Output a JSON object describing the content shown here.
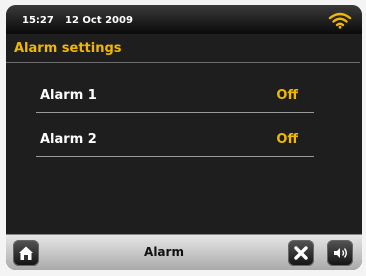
{
  "status": {
    "time": "15:27",
    "date": "12 Oct  2009",
    "wifi_icon": "wifi-icon"
  },
  "page": {
    "title": "Alarm settings"
  },
  "alarms": [
    {
      "label": "Alarm 1",
      "value": "Off"
    },
    {
      "label": "Alarm 2",
      "value": "Off"
    }
  ],
  "bottombar": {
    "title": "Alarm",
    "left_icon": "home-icon",
    "right_icons": [
      "close-icon",
      "volume-icon"
    ]
  },
  "colors": {
    "accent": "#f0b800",
    "background": "#1e1e1e",
    "text": "#ffffff"
  }
}
